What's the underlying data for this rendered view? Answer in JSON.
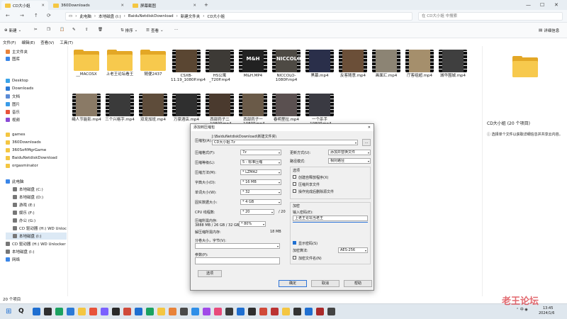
{
  "tabs": [
    {
      "label": "CD大小姐",
      "active": true
    },
    {
      "label": "360Downloads",
      "active": false
    },
    {
      "label": "屏幕截图",
      "active": false
    }
  ],
  "window_controls": {
    "min": "—",
    "max": "☐",
    "close": "✕"
  },
  "address": {
    "crumbs": [
      "此电脑",
      "本地磁盘 (I:)",
      "BaiduNetdiskDownload",
      "新建文件夹",
      "CD大小姐"
    ],
    "search_placeholder": "在 CD大小姐 中搜索"
  },
  "commandbar": {
    "new": "新建",
    "sort": "排序",
    "view": "查看",
    "details": "详细信息"
  },
  "menu": [
    "文件(F)",
    "编辑(E)",
    "查看(V)",
    "工具(T)"
  ],
  "sidebar": {
    "items": [
      {
        "label": "主文件夹",
        "color": "#e8833a",
        "indent": 0
      },
      {
        "label": "图库",
        "color": "#3a86e8",
        "indent": 0
      },
      {
        "label": "Desktop",
        "color": "#3aa3e8",
        "indent": 0
      },
      {
        "label": "Downloads",
        "color": "#2b79d6",
        "indent": 0
      },
      {
        "label": "文档",
        "color": "#5b8bd6",
        "indent": 0
      },
      {
        "label": "图片",
        "color": "#3a9be8",
        "indent": 0
      },
      {
        "label": "音乐",
        "color": "#e8533a",
        "indent": 0
      },
      {
        "label": "视频",
        "color": "#8a4ad6",
        "indent": 0
      },
      {
        "label": "games",
        "color": "#f4c642",
        "indent": 0
      },
      {
        "label": "360Downloads",
        "color": "#f4c642",
        "indent": 0
      },
      {
        "label": "360SoftMgrGame",
        "color": "#f4c642",
        "indent": 0
      },
      {
        "label": "BaiduNetdiskDownload",
        "color": "#f4c642",
        "indent": 0
      },
      {
        "label": "orgasminator",
        "color": "#f4c642",
        "indent": 0
      },
      {
        "label": "此电脑",
        "color": "#3a86e8",
        "indent": 0
      },
      {
        "label": "本地磁盘 (C:)",
        "color": "#777",
        "indent": 1
      },
      {
        "label": "本地磁盘 (D:)",
        "color": "#777",
        "indent": 1
      },
      {
        "label": "游戏 (E:)",
        "color": "#777",
        "indent": 1
      },
      {
        "label": "娱乐 (F:)",
        "color": "#777",
        "indent": 1
      },
      {
        "label": "办公 (G:)",
        "color": "#777",
        "indent": 1
      },
      {
        "label": "CD 驱动器 (H:) WD Unlocker",
        "color": "#777",
        "indent": 1
      },
      {
        "label": "本地磁盘 (I:)",
        "color": "#777",
        "indent": 1,
        "selected": true
      },
      {
        "label": "CD 驱动器 (H:) WD Unlocker",
        "color": "#777",
        "indent": 0
      },
      {
        "label": "本地磁盘 (I:)",
        "color": "#777",
        "indent": 0
      },
      {
        "label": "网络",
        "color": "#3a86e8",
        "indent": 0
      }
    ]
  },
  "files_row1": [
    {
      "name": "__MACOSX",
      "kind": "folder"
    },
    {
      "name": "上老王论坛看王",
      "kind": "folder"
    },
    {
      "name": "随便2437",
      "kind": "folder"
    },
    {
      "name": "CSXB-11.19_1080P.mp4",
      "kind": "video",
      "bg": "#5a4632"
    },
    {
      "name": "HS公寓_720P.mp4",
      "kind": "video",
      "bg": "#3d3a36"
    },
    {
      "name": "M&H.MP4",
      "kind": "video",
      "bg": "#222",
      "overlay": "M&H"
    },
    {
      "name": "NICCOLO-1080P.mp4",
      "kind": "video",
      "bg": "#4e4a44",
      "overlay": "NICCOLO"
    },
    {
      "name": "黑幕.mp4",
      "kind": "video",
      "bg": "#2a2f4a"
    },
    {
      "name": "反客随意.mp4",
      "kind": "video",
      "bg": "#6b4f38"
    },
    {
      "name": "画面汇.mp4",
      "kind": "video",
      "bg": "#8c8474"
    },
    {
      "name": "厅客组超.mp4",
      "kind": "video",
      "bg": "#a58f6c"
    },
    {
      "name": "城华围城.mp4",
      "kind": "video",
      "bg": "#3f3f3f"
    }
  ],
  "files_row2": [
    {
      "name": "绳人节能影.mp4",
      "kind": "video",
      "bg": "#8a7a66"
    },
    {
      "name": "三个兴格字.mp4",
      "kind": "video",
      "bg": "#3a3a3a"
    },
    {
      "name": "双宠加班.mp4",
      "kind": "video",
      "bg": "#5e4c3a"
    },
    {
      "name": "万豪酒店.mp4",
      "kind": "video",
      "bg": "#2f2f2f"
    },
    {
      "name": "西部药子二_1080P.mp4",
      "kind": "video",
      "bg": "#4a3a2e"
    },
    {
      "name": "西部药子一_1080P.mp4",
      "kind": "video",
      "bg": "#6a5a48"
    },
    {
      "name": "春明里拉.mp4",
      "kind": "video",
      "bg": "#5a5050"
    },
    {
      "name": "一个杀手_1080P.mp4",
      "kind": "video",
      "bg": "#3a3a42"
    }
  ],
  "details": {
    "title": "CD大小姐 (20 个项目)",
    "hint": "选择单个文件以获取详细信息并共享云内容。"
  },
  "status": {
    "count": "20 个项目"
  },
  "dialog": {
    "title": "添加到压缩包",
    "archive_label": "压缩包(A):",
    "archive_path": "J:\\BaiduNetdiskDownload\\新建文件夹\\",
    "archive_name": "CD大小姐.7z",
    "browse": "...",
    "left": [
      {
        "label": "压缩格式(F):",
        "value": "7z"
      },
      {
        "label": "压缩等级(L):",
        "value": "5 - 标准压缩"
      },
      {
        "label": "压缩方法(M):",
        "value": "* LZMA2"
      },
      {
        "label": "字典大小(D):",
        "value": "* 16 MB"
      },
      {
        "label": "单词大小(W):",
        "value": "* 32"
      },
      {
        "label": "固实数据大小:",
        "value": "* 4 GB"
      },
      {
        "label": "CPU 线程数:",
        "value": "* 20"
      }
    ],
    "threads_total": "/ 20",
    "memory_label": "压缩所需内存:",
    "memory_detail": "3888 MB / 26 GB / 32 GB",
    "memory_pct": "* 80%",
    "decomp_label": "解压缩所需内存:",
    "decomp_value": "18 MB",
    "split_label": "分卷大小，字节(V):",
    "params_label": "参数(P):",
    "options_button": "选项",
    "right": [
      {
        "label": "更新方式(U):",
        "value": "添加并替换文件"
      },
      {
        "label": "路径模式:",
        "value": "相对路径"
      }
    ],
    "options_title": "选项",
    "options": [
      {
        "label": "创建自释放程序(X)",
        "checked": false
      },
      {
        "label": "压缩共享文件",
        "checked": false
      },
      {
        "label": "操作完成后删除源文件",
        "checked": false
      }
    ],
    "encrypt_title": "加密",
    "password_label": "输入密码(E):",
    "password_value": "上老王论坛当老王",
    "show_password": "显示密码(S)",
    "method_label": "加密算法:",
    "method_value": "AES-256",
    "encrypt_names": "加密文件名(N)",
    "ok": "确定",
    "cancel": "取消",
    "help": "帮助"
  },
  "taskbar": {
    "search": "Q",
    "time": "13:45",
    "date": "2024/1/6",
    "icons": [
      "#1f6fd1",
      "#2f2f2f",
      "#1aa260",
      "#2b79d6",
      "#f4c642",
      "#e8533a",
      "#7b61ff",
      "#2a2a2a",
      "#d04a3a",
      "#1f6fd1",
      "#1aa260",
      "#f4c642",
      "#e8833a",
      "#4a4a4a",
      "#2f8fe8",
      "#a04ae8",
      "#e84a7a",
      "#3a3a3a",
      "#1f6fd1",
      "#2f2f2f",
      "#d04a3a",
      "#b33",
      "#f4c642",
      "#333",
      "#1f6fd1",
      "#aa2a2a",
      "#444"
    ]
  },
  "watermark": "老王论坛"
}
